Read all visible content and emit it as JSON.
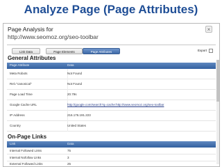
{
  "slide": {
    "title": "Analyze Page (Page Attributes)"
  },
  "panel": {
    "title": "Page Analysis for",
    "url": "http://www.seomoz.org/seo-toolbar",
    "close_symbol": "×"
  },
  "tabs": [
    {
      "label": "Link Data",
      "active": false
    },
    {
      "label": "Page Elements",
      "active": false
    },
    {
      "label": "Page Attributes",
      "active": true
    }
  ],
  "export": {
    "label": "Export"
  },
  "general_attributes": {
    "title": "General Attributes",
    "columns": [
      "Page Attribute",
      "Data"
    ],
    "rows": [
      {
        "attribute": "Meta Robots",
        "value": "Not Found"
      },
      {
        "attribute": "Rel=\"canonical\"",
        "value": "Not Found"
      },
      {
        "attribute": "Page Load Time",
        "value": "20.79s"
      },
      {
        "attribute": "Google Cache URL",
        "value": "http://google.com/search?q=cache:http://www.seomoz.org/seo-toolbar"
      },
      {
        "attribute": "IP Address",
        "value": "216.176.191.223"
      },
      {
        "attribute": "Country",
        "value": "United States"
      }
    ]
  },
  "on_page_links": {
    "title": "On-Page Links",
    "columns": [
      "Link",
      "Data"
    ],
    "rows": [
      {
        "attribute": "Internal Followed Links",
        "value": "75"
      },
      {
        "attribute": "Internal Nofollow Links",
        "value": "3"
      },
      {
        "attribute": "External Followed Links",
        "value": "25"
      }
    ]
  }
}
